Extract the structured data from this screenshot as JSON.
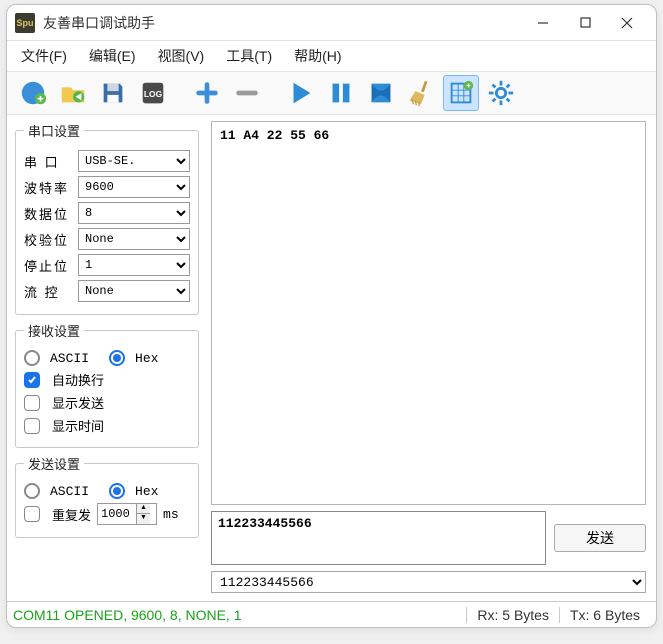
{
  "window": {
    "title": "友善串口调试助手",
    "app_icon_text": "Spu"
  },
  "menus": {
    "file": "文件(F)",
    "edit": "编辑(E)",
    "view": "视图(V)",
    "tools": "工具(T)",
    "help": "帮助(H)"
  },
  "serial": {
    "legend": "串口设置",
    "port_label": "串  口",
    "port_value": "USB-SE. ",
    "baud_label": "波特率",
    "baud_value": "9600",
    "data_label": "数据位",
    "data_value": "8",
    "parity_label": "校验位",
    "parity_value": "None",
    "stop_label": "停止位",
    "stop_value": "1",
    "flow_label": "流  控",
    "flow_value": "None"
  },
  "recv": {
    "legend": "接收设置",
    "ascii": "ASCII",
    "hex": "Hex",
    "auto_wrap": "自动换行",
    "show_send": "显示发送",
    "show_time": "显示时间"
  },
  "send": {
    "legend": "发送设置",
    "ascii": "ASCII",
    "hex": "Hex",
    "repeat": "重复发",
    "interval": "1000",
    "unit": "ms"
  },
  "rx_content": "11 A4 22 55 66",
  "tx_content": "112233445566",
  "send_button": "发送",
  "history_value": "112233445566",
  "status": {
    "left": "COM11 OPENED, 9600, 8, NONE, 1",
    "rx": "Rx: 5 Bytes",
    "tx": "Tx: 6 Bytes"
  }
}
